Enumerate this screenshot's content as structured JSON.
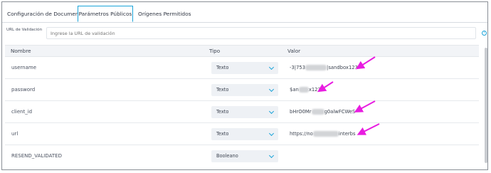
{
  "tabs": [
    {
      "label": "Configuración de Documento"
    },
    {
      "label": "Parámetros Públicos"
    },
    {
      "label": "Orígenes Permitidos"
    }
  ],
  "url_field": {
    "label": "URL de Validación",
    "placeholder": "Ingrese la URL de validación"
  },
  "table": {
    "headers": {
      "name": "Nombre",
      "type": "Tipo",
      "value": "Valor"
    },
    "rows": [
      {
        "name": "username",
        "type": "Texto",
        "value_start": "-3|753",
        "value_end": "|sandbox123"
      },
      {
        "name": "password",
        "type": "Texto",
        "value_start": "$an",
        "value_end": "x123"
      },
      {
        "name": "client_id",
        "type": "Texto",
        "value_start": "bHrO0Mr",
        "value_end": "g0alwFCWeS"
      },
      {
        "name": "url",
        "type": "Texto",
        "value_start": "https://no",
        "value_end": "interbs"
      },
      {
        "name": "RESEND_VALIDATED",
        "type": "Booleano",
        "value_start": "",
        "value_end": ""
      }
    ]
  },
  "annotation_color": "#e81ce0",
  "accent_color": "#1aa3d9"
}
